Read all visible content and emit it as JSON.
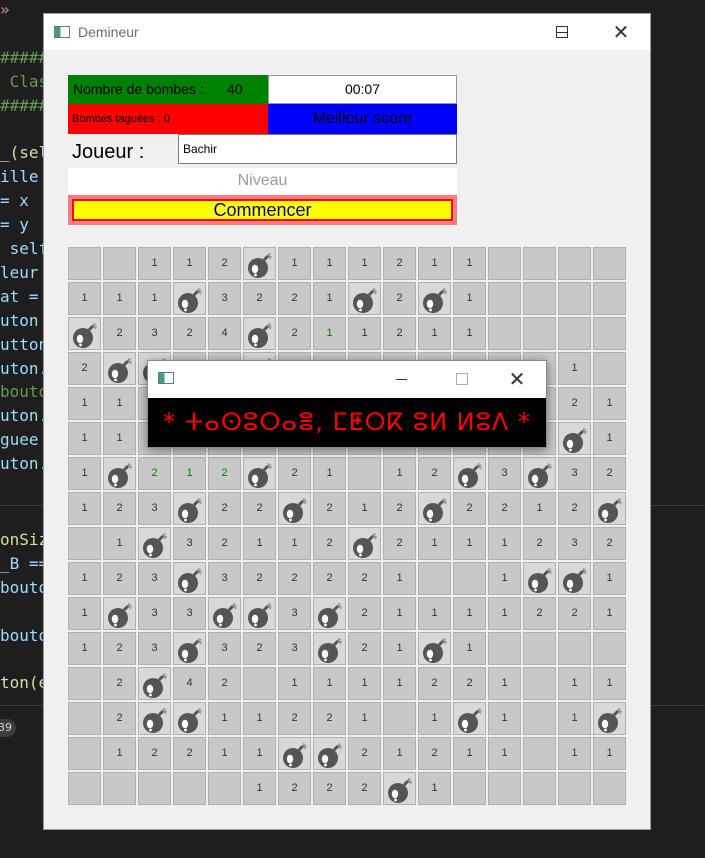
{
  "editor": {
    "lines": [
      {
        "text": "»",
        "color": "#c586c0"
      },
      {
        "text": "",
        "color": "#9cdcfe"
      },
      {
        "text": "#####",
        "color": "#6a9955"
      },
      {
        "text": " Clas",
        "color": "#6a9955"
      },
      {
        "text": "#####",
        "color": "#6a9955"
      },
      {
        "text": "",
        "color": "#9cdcfe"
      },
      {
        "text": "_(sel",
        "color": "#dcdcaa"
      },
      {
        "text": "ille",
        "color": "#9cdcfe"
      },
      {
        "text": "= x",
        "color": "#9cdcfe"
      },
      {
        "text": "= y",
        "color": "#9cdcfe"
      },
      {
        "text": " self",
        "color": "#9cdcfe"
      },
      {
        "text": "leur",
        "color": "#9cdcfe"
      },
      {
        "text": "at =",
        "color": "#9cdcfe"
      },
      {
        "text": "uton",
        "color": "#9cdcfe"
      },
      {
        "text": "utton",
        "color": "#9cdcfe"
      },
      {
        "text": "uton.",
        "color": "#9cdcfe"
      },
      {
        "text": "bouton",
        "color": "#6a9955"
      },
      {
        "text": "uton.",
        "color": "#9cdcfe"
      },
      {
        "text": "guee",
        "color": "#9cdcfe"
      },
      {
        "text": "uton.",
        "color": "#9cdcfe"
      }
    ],
    "lines2": [
      {
        "text": "onSiz",
        "color": "#dcdcaa"
      },
      {
        "text": "_B ==",
        "color": "#9cdcfe"
      },
      {
        "text": "bouto",
        "color": "#9cdcfe"
      },
      {
        "text": "",
        "color": "#9cdcfe"
      },
      {
        "text": "bouto",
        "color": "#9cdcfe"
      },
      {
        "text": "",
        "color": "#9cdcfe"
      },
      {
        "text": "ton(e",
        "color": "#dcdcaa"
      }
    ],
    "badge": "39"
  },
  "window": {
    "title": "Demineur"
  },
  "game": {
    "bombs_label": "Nombre de bombes :",
    "bombs_count": "40",
    "timer": "00:07",
    "tagged_label": "Bombes taguées : 0",
    "best_score_label": "Meilleur score",
    "player_label": "Joueur :",
    "player_value": "Bachir",
    "level_label": "Niveau",
    "start_label": "Commencer"
  },
  "board": {
    "rows": [
      [
        "",
        "",
        "1",
        "1",
        "2",
        "B",
        "1",
        "1",
        "1",
        "2",
        "1",
        "1",
        "",
        "",
        "",
        ""
      ],
      [
        "1",
        "1",
        "1",
        "B",
        "3",
        "2",
        "2",
        "1",
        "B",
        "2",
        "B",
        "1",
        "",
        "",
        "",
        ""
      ],
      [
        "B",
        "2",
        "3",
        "2",
        "4",
        "B",
        "2",
        "1g",
        "1",
        "2",
        "1",
        "1",
        "",
        "",
        "",
        ""
      ],
      [
        "2",
        "B",
        "B",
        "",
        "",
        "B",
        "",
        "",
        "",
        "",
        "",
        "",
        "",
        "",
        "1",
        ""
      ],
      [
        "1",
        "1",
        "",
        "",
        "",
        "",
        "",
        "",
        "",
        "",
        "",
        "",
        "",
        "",
        "2",
        "1"
      ],
      [
        "1",
        "1",
        "",
        "",
        "",
        "",
        "",
        "",
        "",
        "",
        "",
        "",
        "",
        "",
        "B",
        "1"
      ],
      [
        "1",
        "B",
        "2g",
        "1g",
        "2g",
        "B",
        "2",
        "1",
        "",
        "1",
        "2",
        "B",
        "3",
        "B",
        "3",
        "2"
      ],
      [
        "1",
        "2",
        "3",
        "B",
        "2",
        "2",
        "B",
        "2",
        "1",
        "2",
        "B",
        "2",
        "2",
        "1",
        "2",
        "B"
      ],
      [
        "",
        "1",
        "B",
        "3",
        "2",
        "1",
        "1",
        "2",
        "B",
        "2",
        "1",
        "1",
        "1",
        "2",
        "3",
        "2"
      ],
      [
        "1",
        "2",
        "3",
        "B",
        "3",
        "2",
        "2",
        "2",
        "2",
        "1",
        "",
        "",
        "1",
        "B",
        "B",
        "1"
      ],
      [
        "1",
        "B",
        "3",
        "3",
        "B",
        "B",
        "3",
        "B",
        "2",
        "1",
        "1",
        "1",
        "1",
        "2",
        "2",
        "1"
      ],
      [
        "1",
        "2",
        "3",
        "B",
        "3",
        "2",
        "3",
        "B",
        "2",
        "1",
        "B",
        "1",
        "",
        "",
        "",
        ""
      ],
      [
        "",
        "2",
        "B",
        "4",
        "2",
        "",
        "1",
        "1",
        "1",
        "1",
        "2",
        "2",
        "1",
        "",
        "1",
        "1"
      ],
      [
        "",
        "2",
        "B",
        "B",
        "1",
        "1",
        "2",
        "2",
        "1",
        "",
        "1",
        "B",
        "1",
        "",
        "1",
        "B"
      ],
      [
        "",
        "1",
        "2",
        "2",
        "1",
        "1",
        "B",
        "B",
        "2",
        "1",
        "2",
        "1",
        "1",
        "",
        "1",
        "1"
      ],
      [
        "",
        "",
        "",
        "",
        "",
        "1",
        "2",
        "2",
        "2",
        "B",
        "1",
        "",
        "",
        "",
        "",
        ""
      ]
    ]
  },
  "popup": {
    "message": "* ⵜⴰⵙⵓⵔⴰⴻ, ⵎⵟⵔⴽ ⵓⵍ ⵍⵓⴷ *"
  }
}
